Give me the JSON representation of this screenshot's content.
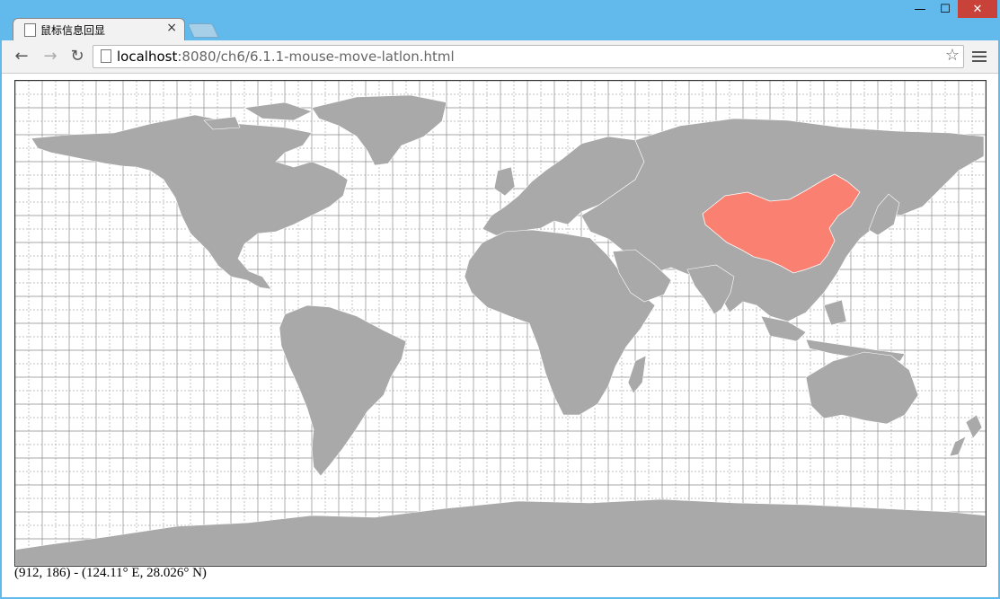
{
  "browser": {
    "tab_title": "鼠标信息回显",
    "url_host": "localhost",
    "url_rest": ":8080/ch6/6.1.1-mouse-move-latlon.html",
    "window_buttons": {
      "minimize": "—",
      "maximize": "☐",
      "close": "✕"
    }
  },
  "icons": [
    "page-icon",
    "close-icon",
    "back-icon",
    "forward-icon",
    "reload-icon",
    "star-icon",
    "menu-icon"
  ],
  "map": {
    "projection": "equirectangular",
    "graticule": "10° solid, 5° dashed",
    "land_color": "#a9a9a9",
    "highlight_color": "#fa8072",
    "highlighted_country": "China"
  },
  "status": {
    "coord_text": "(912, 186) - (124.11° E, 28.026° N)"
  }
}
